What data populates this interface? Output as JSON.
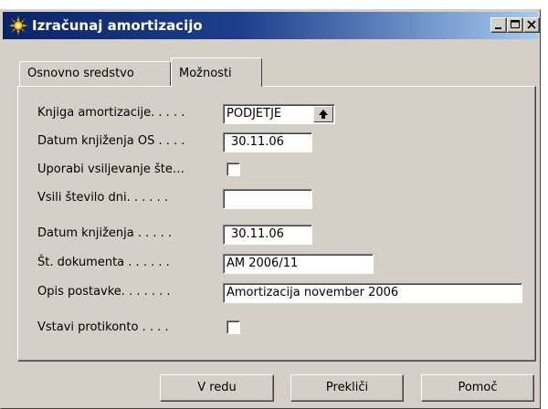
{
  "window": {
    "title": "Izračunaj amortizacijo",
    "icon": "gear-sparkle-icon",
    "controls": [
      "minimize-icon",
      "maximize-icon",
      "close-icon"
    ]
  },
  "tabs": [
    {
      "label": "Osnovno sredstvo",
      "active": false
    },
    {
      "label": "Možnosti",
      "active": true
    }
  ],
  "form": {
    "depreciation_book": {
      "label": "Knjiga amortizacije. . . . .",
      "value": "PODJETJE"
    },
    "fa_posting_date": {
      "label": "Datum knjiženja OS . . . .",
      "value": "30.11.06"
    },
    "use_force_days": {
      "label": "Uporabi vsiljevanje šte…",
      "checked": false
    },
    "force_days": {
      "label": "Vsili število dni. . . . . .",
      "value": ""
    },
    "posting_date": {
      "label": "Datum knjiženja . . . . .",
      "value": "30.11.06"
    },
    "document_no": {
      "label": "Št. dokumenta . . . . . .",
      "value": "AM 2006/11"
    },
    "posting_description": {
      "label": "Opis postavke. . . . . . .",
      "value": "Amortizacija november 2006"
    },
    "insert_bal_account": {
      "label": "Vstavi protikonto . . . .",
      "checked": false
    }
  },
  "buttons": {
    "ok": "V redu",
    "cancel": "Prekliči",
    "help": "Pomoč"
  },
  "colors": {
    "titlebar_start": "#0a246a",
    "titlebar_end": "#a6caf0",
    "face": "#d4d0c8"
  }
}
